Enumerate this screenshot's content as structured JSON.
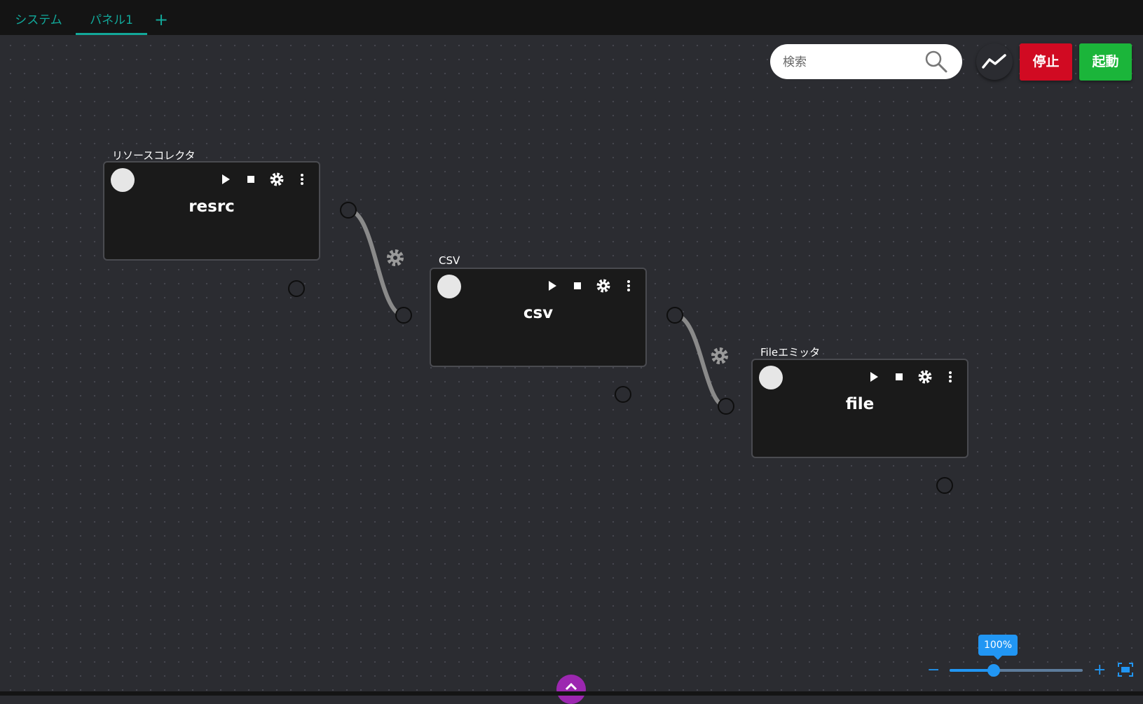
{
  "tabs": [
    {
      "label": "システム",
      "active": false
    },
    {
      "label": "パネル1",
      "active": true
    }
  ],
  "add_tab_icon": "plus-icon",
  "search": {
    "placeholder": "検索",
    "icon": "search-icon"
  },
  "toolbar": {
    "trend_icon": "trend-chart-icon",
    "stop_label": "停止",
    "start_label": "起動"
  },
  "nodes": [
    {
      "title": "リソースコレクタ",
      "name": "resrc"
    },
    {
      "title": "CSV",
      "name": "csv"
    },
    {
      "title": "Fileエミッタ",
      "name": "file"
    }
  ],
  "node_controls": [
    "play-icon",
    "stop-icon",
    "gear-icon",
    "more-vert-icon"
  ],
  "zoom": {
    "label": "100%",
    "level": 0.33
  },
  "colors": {
    "accent_tab": "#12a89a",
    "stop": "#d10a22",
    "start": "#1bb53a",
    "zoom": "#2196f3",
    "collapse": "#9c27b0"
  }
}
